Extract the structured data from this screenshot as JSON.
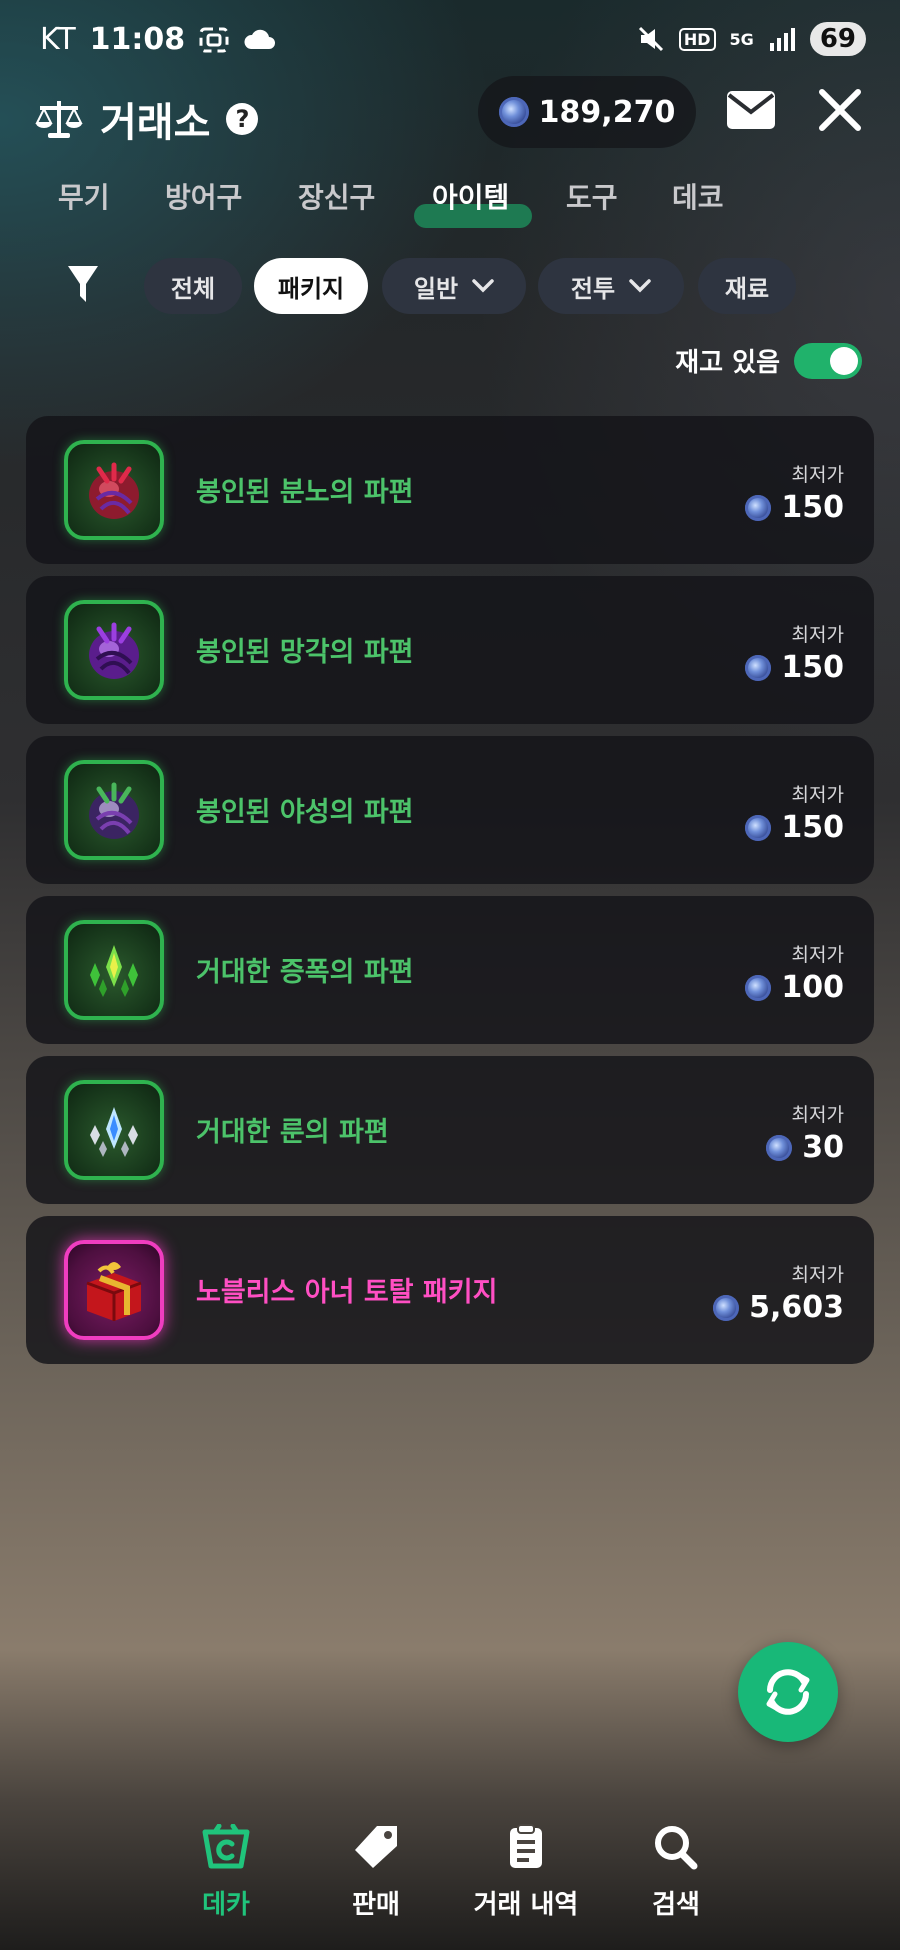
{
  "status_bar": {
    "carrier": "KT",
    "time": "11:08",
    "network": "5G",
    "hd": "HD",
    "battery": "69"
  },
  "header": {
    "title": "거래소",
    "currency_amount": "189,270"
  },
  "tabs": [
    {
      "label": "무기",
      "active": false
    },
    {
      "label": "방어구",
      "active": false
    },
    {
      "label": "장신구",
      "active": false
    },
    {
      "label": "아이템",
      "active": true
    },
    {
      "label": "도구",
      "active": false
    },
    {
      "label": "데코",
      "active": false
    }
  ],
  "filters": [
    {
      "label": "전체",
      "active": false,
      "dropdown": false
    },
    {
      "label": "패키지",
      "active": true,
      "dropdown": false
    },
    {
      "label": "일반",
      "active": false,
      "dropdown": true
    },
    {
      "label": "전투",
      "active": false,
      "dropdown": true
    },
    {
      "label": "재료",
      "active": false,
      "dropdown": false
    }
  ],
  "stock_toggle": {
    "label": "재고 있음",
    "on": true
  },
  "items": [
    {
      "name": "봉인된 분노의 파편",
      "price_label": "최저가",
      "price": "150",
      "rarity": "green",
      "icon": "red-sealed-shard-icon"
    },
    {
      "name": "봉인된 망각의 파편",
      "price_label": "최저가",
      "price": "150",
      "rarity": "green",
      "icon": "purple-sealed-shard-icon"
    },
    {
      "name": "봉인된 야성의 파편",
      "price_label": "최저가",
      "price": "150",
      "rarity": "green",
      "icon": "green-sealed-shard-icon"
    },
    {
      "name": "거대한 증폭의 파편",
      "price_label": "최저가",
      "price": "100",
      "rarity": "green",
      "icon": "green-crystal-cluster-icon"
    },
    {
      "name": "거대한 룬의 파편",
      "price_label": "최저가",
      "price": "30",
      "rarity": "green",
      "icon": "blue-crystal-cluster-icon"
    },
    {
      "name": "노블리스 아너 토탈 패키지",
      "price_label": "최저가",
      "price": "5,603",
      "rarity": "pink",
      "icon": "red-gift-box-icon"
    }
  ],
  "bottom_nav": [
    {
      "label": "데카",
      "active": true,
      "icon": "basket-icon"
    },
    {
      "label": "판매",
      "active": false,
      "icon": "tag-icon"
    },
    {
      "label": "거래 내역",
      "active": false,
      "icon": "clipboard-icon"
    },
    {
      "label": "검색",
      "active": false,
      "icon": "search-icon"
    }
  ],
  "colors": {
    "accent_green": "#20c47c",
    "rarity_green": "#4cc36a",
    "rarity_pink": "#ff4fc3"
  }
}
